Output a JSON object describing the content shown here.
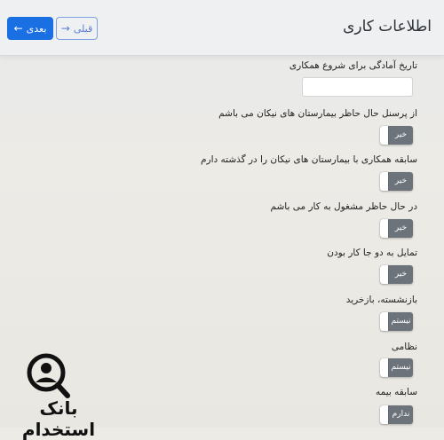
{
  "header": {
    "title": "اطلاعات کاری",
    "next_label": "بعدی",
    "prev_label": "قبلی"
  },
  "form": {
    "start_date_label": "تاریخ آمادگی برای شروع همکاری",
    "q1_label": "از پرسنل حال حاظر بیمارستان های نیکان می باشم",
    "q1_value": "خیر",
    "q2_label": "سابقه همکاری با بیمارستان های نیکان را در گذشته دارم",
    "q2_value": "خیر",
    "q3_label": "در حال حاظر مشغول به کار می باشم",
    "q3_value": "خیر",
    "q4_label": "تمایل به دو جا کار بودن",
    "q4_value": "خیر",
    "q5_label": "بازنشسته، بازخرید",
    "q5_value": "نیستم",
    "q6_label": "نظامی",
    "q6_value": "نیستم",
    "q7_label": "سابقه بیمه",
    "q7_value": "ندارم"
  },
  "watermark": {
    "text": "بانک استخدام"
  },
  "colors": {
    "primary": "#1a6fe3",
    "toggle_off": "#6c737b"
  }
}
